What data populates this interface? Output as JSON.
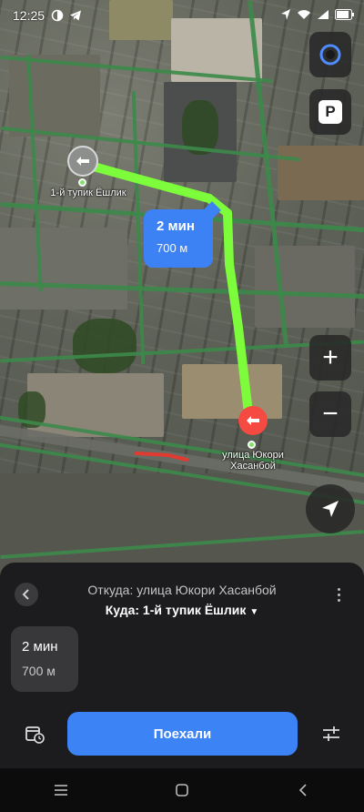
{
  "status_bar": {
    "time": "12:25",
    "left_icons": [
      "brightness-icon",
      "telegram-icon"
    ],
    "right_icons": [
      "location-icon",
      "wifi-icon",
      "signal-icon",
      "battery-icon"
    ]
  },
  "map": {
    "labels": {
      "start_street": "1-й тупик Ёшлик",
      "end_street_line1": "улица Юкори",
      "end_street_line2": "Хасанбой"
    },
    "route_bubble": {
      "time": "2 мин",
      "distance": "700 м"
    },
    "controls": {
      "parking_label": "P",
      "zoom_in": "+",
      "zoom_out": "−"
    },
    "colors": {
      "route": "#7cfc3a",
      "bubble": "#3d82f5",
      "end_pin": "#f44a42"
    }
  },
  "sheet": {
    "from": "Откуда: улица Юкори Хасанбой",
    "to": "Куда: 1-й тупик Ёшлик",
    "to_caret": "▼",
    "route_card": {
      "time": "2 мин",
      "distance": "700 м"
    },
    "go_button": "Поехали",
    "go_color": "#3c83f6"
  },
  "navbar": {
    "icons": [
      "menu-icon",
      "home-icon",
      "back-icon"
    ]
  }
}
